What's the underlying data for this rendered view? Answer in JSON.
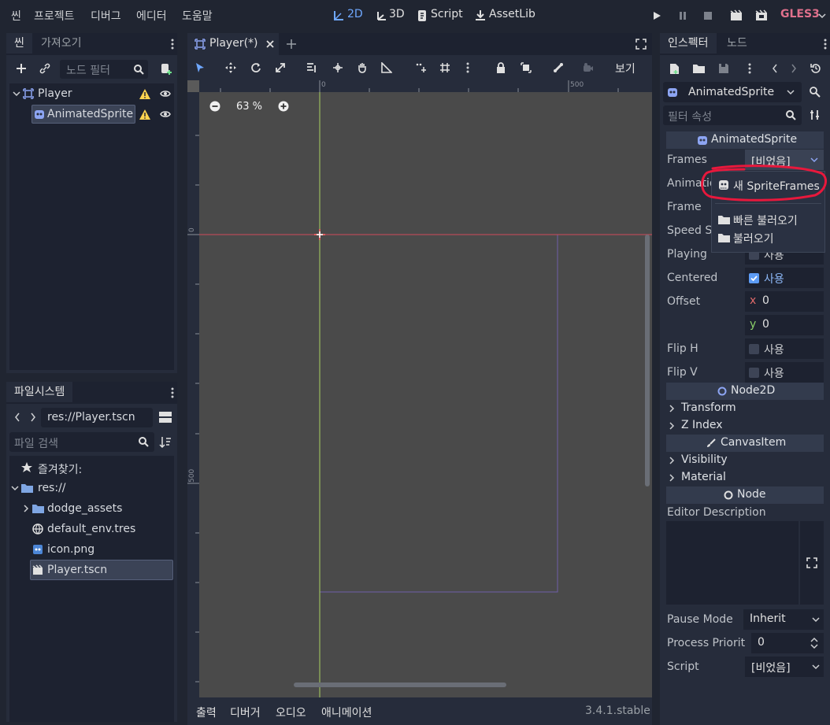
{
  "menu": [
    "씬",
    "프로젝트",
    "디버그",
    "에디터",
    "도움말"
  ],
  "workspaces": [
    "2D",
    "3D",
    "Script",
    "AssetLib"
  ],
  "renderer": "GLES3",
  "colors": {
    "accent": "#6fa8ff",
    "renderer": "#e0708c",
    "highlight_circle": "#e8183c",
    "warning": "#ffd34f"
  },
  "scene_dock": {
    "tabs": [
      "씬",
      "가져오기"
    ],
    "filter_placeholder": "노드 필터",
    "nodes": [
      {
        "label": "Player",
        "icon": "node2d-icon",
        "warning": true
      },
      {
        "label": "AnimatedSprite",
        "icon": "animated-sprite-icon",
        "warning": true,
        "selected": true
      }
    ]
  },
  "filesystem_dock": {
    "tab": "파일시스템",
    "path": "res://Player.tscn",
    "search_placeholder": "파일 검색",
    "favorites": "즐겨찾기:",
    "root": "res://",
    "items": [
      "dodge_assets",
      "default_env.tres",
      "icon.png",
      "Player.tscn"
    ]
  },
  "editor": {
    "tab": "Player(*)",
    "view_label": "보기",
    "zoom": "63 %",
    "ruler_h": [
      "0",
      "500"
    ],
    "ruler_v": [
      "0",
      "500"
    ]
  },
  "bottom_panel": {
    "tabs": [
      "출력",
      "디버거",
      "오디오",
      "애니메이션"
    ],
    "version": "3.4.1.stable"
  },
  "inspector": {
    "tabs": [
      "인스펙터",
      "노드"
    ],
    "node_name": "AnimatedSprite",
    "filter_placeholder": "필터 속성",
    "section_title": "AnimatedSprite",
    "props": {
      "frames_label": "Frames",
      "frames_value": "[비었음]",
      "animation_label": "Animatio",
      "frame_label": "Frame",
      "speed_label": "Speed Sc",
      "playing_label": "Playing",
      "playing_value": "사용",
      "centered_label": "Centered",
      "centered_value": "사용",
      "offset_label": "Offset",
      "offset_x_axis": "x",
      "offset_x": "0",
      "offset_y_axis": "y",
      "offset_y": "0",
      "flip_h_label": "Flip H",
      "flip_h_value": "사용",
      "flip_v_label": "Flip V",
      "flip_v_value": "사용"
    },
    "node2d_title": "Node2D",
    "node2d_groups": [
      "Transform",
      "Z Index"
    ],
    "canvas_title": "CanvasItem",
    "canvas_groups": [
      "Visibility",
      "Material"
    ],
    "node_title": "Node",
    "editor_description_label": "Editor Description",
    "pause_mode_label": "Pause Mode",
    "pause_mode_value": "Inherit",
    "process_priority_label": "Process Priorit",
    "process_priority_value": "0",
    "script_label": "Script",
    "script_value": "[비었음]"
  },
  "dropdown": {
    "items": [
      "새 SpriteFrames",
      "빠른 불러오기",
      "불러오기"
    ]
  }
}
